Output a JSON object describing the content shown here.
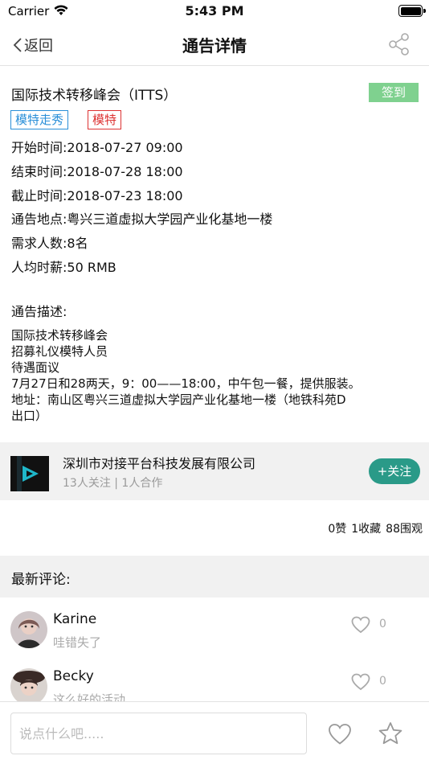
{
  "status_bar": {
    "carrier": "Carrier",
    "time": "5:43 PM"
  },
  "nav": {
    "back_label": "返回",
    "title": "通告详情"
  },
  "notice": {
    "title": "国际技术转移峰会（ITTS）",
    "checkin_label": "签到",
    "tags": [
      "模特走秀",
      "模特"
    ],
    "start_time": "开始时间:2018-07-27 09:00",
    "end_time": "结束时间:2018-07-28 18:00",
    "deadline": "截止时间:2018-07-23 18:00",
    "location": "通告地点:粤兴三道虚拟大学园产业化基地一楼",
    "headcount": "需求人数:8名",
    "pay": "人均时薪:50 RMB",
    "desc_label": "通告描述:",
    "description_lines": [
      "国际技术转移峰会",
      "招募礼仪模特人员",
      "待遇面议",
      "7月27日和28两天，9：00——18:00，中午包一餐，提供服装。",
      "地址：南山区粤兴三道虚拟大学园产业化基地一楼（地铁科苑D",
      "出口）"
    ]
  },
  "company": {
    "name": "深圳市对接平台科技发展有限公司",
    "meta": "13人关注 | 1人合作",
    "follow_label": "+关注"
  },
  "stats": {
    "likes": "0赞",
    "favorites": "1收藏",
    "views": "88围观"
  },
  "comments": {
    "title": "最新评论:",
    "items": [
      {
        "name": "Karine",
        "text": "哇错失了",
        "likes": "0"
      },
      {
        "name": "Becky",
        "text": "这么好的活动",
        "likes": "0"
      }
    ]
  },
  "bottom": {
    "input_placeholder": "说点什么吧....."
  },
  "colors": {
    "checkin_green": "#7fd18f",
    "follow_teal": "#2a9a88",
    "tag_blue": "#2a8fd8",
    "tag_red": "#dd3333"
  }
}
